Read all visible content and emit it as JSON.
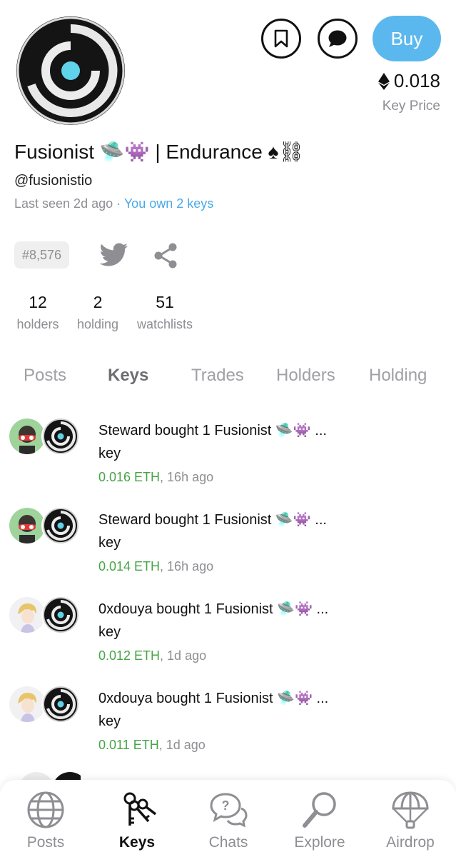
{
  "profile": {
    "name": "Fusionist 🛸👾 | Endurance ♠⛓",
    "handle": "@fusionistio",
    "last_seen": "Last seen 2d ago",
    "separator": "·",
    "own_keys": "You own 2 keys",
    "rank": "#8,576"
  },
  "actions": {
    "buy_label": "Buy",
    "price": "0.018",
    "price_label": "Key Price"
  },
  "stats": [
    {
      "value": "12",
      "label": "holders"
    },
    {
      "value": "2",
      "label": "holding"
    },
    {
      "value": "51",
      "label": "watchlists"
    }
  ],
  "tabs": [
    "Posts",
    "Keys",
    "Trades",
    "Holders",
    "Holding"
  ],
  "active_tab": "Keys",
  "trades": [
    {
      "title": "Steward bought 1 Fusionist 🛸👾 ...",
      "unit": "key",
      "amount": "0.016 ETH",
      "time": ", 16h ago",
      "avatar": "green-goggles-avatar"
    },
    {
      "title": "Steward bought 1 Fusionist 🛸👾 ...",
      "unit": "key",
      "amount": "0.014 ETH",
      "time": ", 16h ago",
      "avatar": "green-goggles-avatar"
    },
    {
      "title": "0xdouya bought 1 Fusionist 🛸👾 ...",
      "unit": "key",
      "amount": "0.012 ETH",
      "time": ", 1d ago",
      "avatar": "blond-anime-avatar"
    },
    {
      "title": "0xdouya bought 1 Fusionist 🛸👾 ...",
      "unit": "key",
      "amount": "0.011 ETH",
      "time": ", 1d ago",
      "avatar": "blond-anime-avatar"
    }
  ],
  "nav": [
    {
      "label": "Posts",
      "icon": "globe-icon"
    },
    {
      "label": "Keys",
      "icon": "keys-icon"
    },
    {
      "label": "Chats",
      "icon": "chat-bubbles-icon"
    },
    {
      "label": "Explore",
      "icon": "magnifier-icon"
    },
    {
      "label": "Airdrop",
      "icon": "parachute-icon"
    }
  ],
  "colors": {
    "accent": "#5bb8ef",
    "link": "#4aa9e6",
    "eth_green": "#47a447",
    "muted": "#8e8e93"
  }
}
